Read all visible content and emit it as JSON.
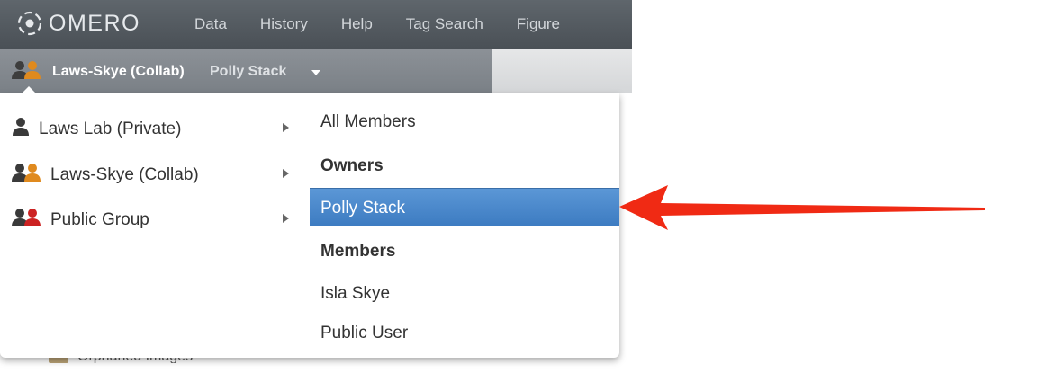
{
  "app": {
    "logo_text": "OMERO"
  },
  "nav": [
    {
      "label": "Data"
    },
    {
      "label": "History"
    },
    {
      "label": "Help"
    },
    {
      "label": "Tag Search"
    },
    {
      "label": "Figure"
    }
  ],
  "group_bar": {
    "group_name": "Laws-Skye (Collab)",
    "user_name": "Polly Stack",
    "icon": "collab-group-icon"
  },
  "dropdown": {
    "groups": [
      {
        "label": "Laws Lab (Private)",
        "icon": "private-group-icon",
        "icon_color": "#3a3a3a"
      },
      {
        "label": "Laws-Skye (Collab)",
        "icon": "collab-group-icon",
        "icon_color": "#e08a1e"
      },
      {
        "label": "Public Group",
        "icon": "public-group-icon",
        "icon_color": "#cc2222"
      }
    ],
    "members": {
      "all_label": "All Members",
      "owners_header": "Owners",
      "owners": [
        "Polly Stack"
      ],
      "members_header": "Members",
      "members": [
        "Isla Skye",
        "Public User"
      ]
    }
  },
  "tree_peek": {
    "label": "Orphaned Images"
  },
  "annotation": {
    "arrow_color": "#f02a14"
  }
}
